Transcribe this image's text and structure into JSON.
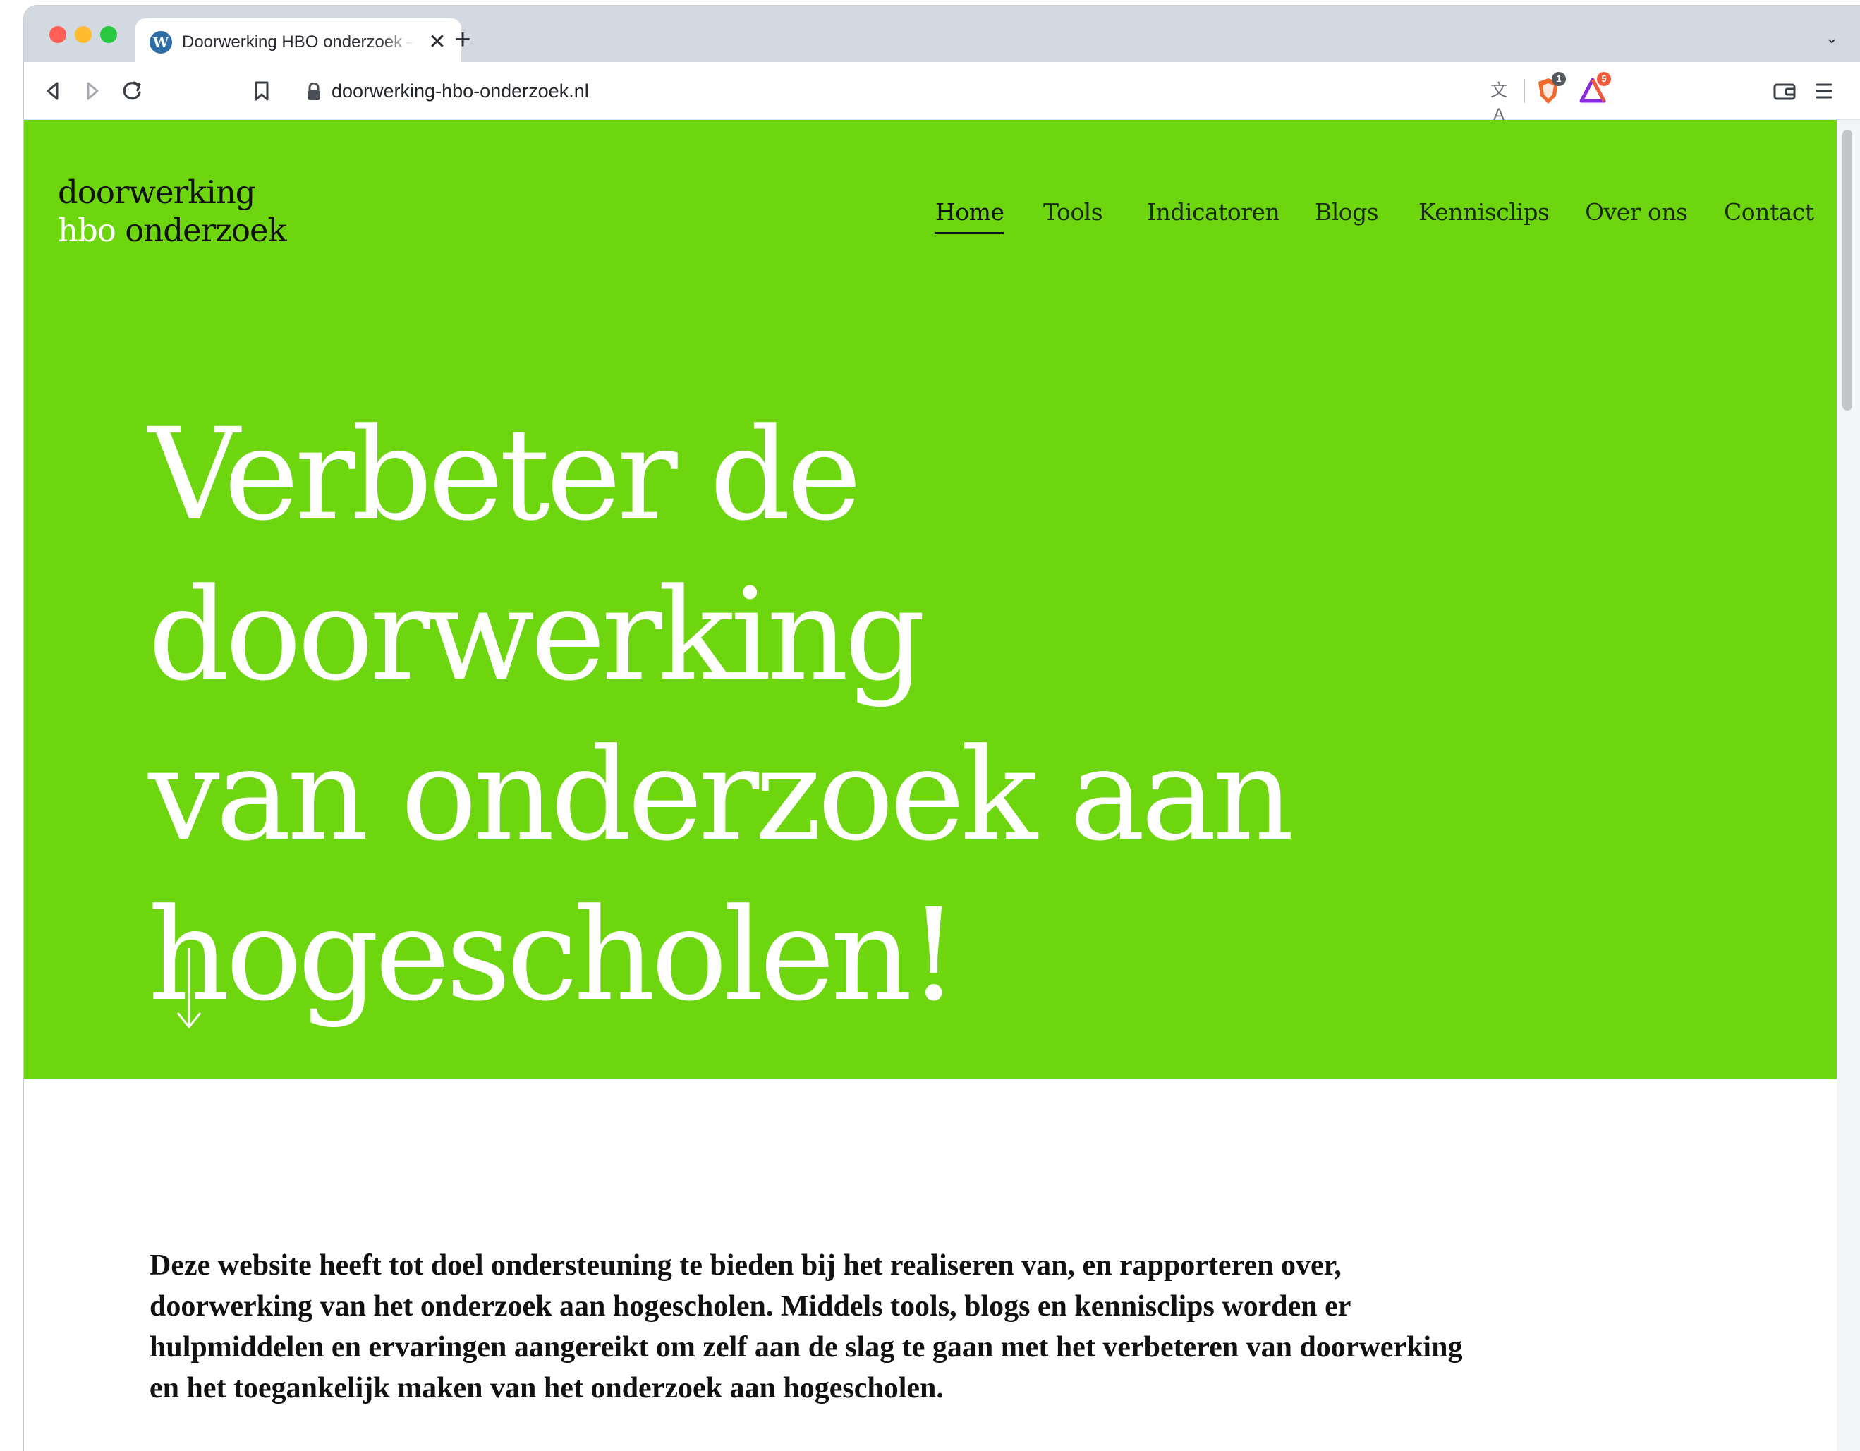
{
  "browser": {
    "tab": {
      "title": "Doorwerking HBO onderzoek – ",
      "favicon": "wordpress-icon",
      "close_glyph": "✕"
    },
    "new_tab_glyph": "+",
    "tab_menu_glyph": "⌄",
    "address_bar": {
      "url": "doorwerking-hbo-onderzoek.nl",
      "translate_glyph": "文A",
      "shields_badge": "1",
      "rewards_badge": "5"
    },
    "icons": [
      "back-icon",
      "forward-icon",
      "reload-icon",
      "bookmark-icon",
      "lock-icon",
      "translate-icon",
      "brave-shields-icon",
      "brave-rewards-icon",
      "wallet-icon",
      "menu-icon"
    ]
  },
  "site": {
    "logo": {
      "line1": "doorwerking",
      "line2_part1": "hbo",
      "line2_part2": " onderzoek"
    },
    "nav": [
      {
        "label": "Home",
        "active": true
      },
      {
        "label": "Tools",
        "active": false
      },
      {
        "label": "Indicatoren",
        "active": false
      },
      {
        "label": "Blogs",
        "active": false
      },
      {
        "label": "Kennisclips",
        "active": false
      },
      {
        "label": "Over ons",
        "active": false
      },
      {
        "label": "Contact",
        "active": false
      }
    ],
    "hero": {
      "line1": "Verbeter de doorwerking",
      "line2": "van onderzoek aan",
      "line3": "hogescholen!",
      "background_color": "#6dd60f"
    },
    "intro": "Deze website heeft tot doel ondersteuning te bieden bij het realiseren van, en rapporteren over, doorwerking van het onderzoek aan hogescholen. Middels tools, blogs en kennisclips worden er hulpmiddelen en ervaringen aangereikt om zelf aan de slag te gaan met het verbeteren van doorwerking en het toegankelijk maken van het onderzoek aan hogescholen."
  }
}
